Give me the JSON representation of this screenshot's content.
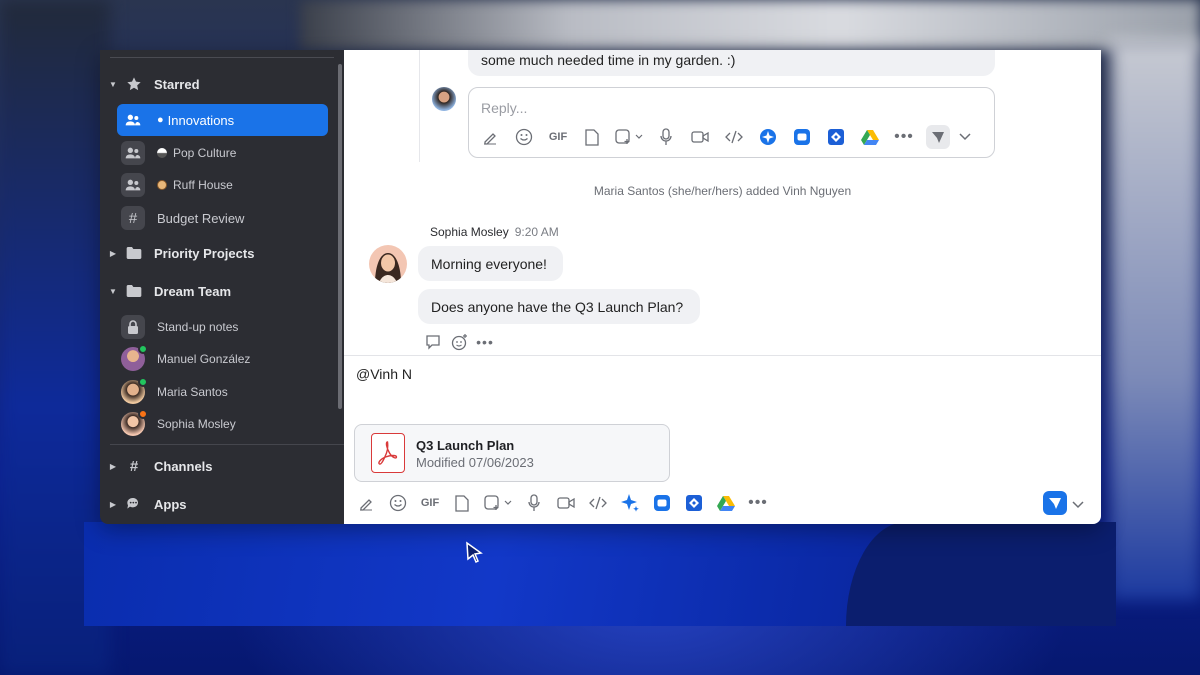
{
  "sidebar": {
    "sections": {
      "starred": "Starred",
      "priority_projects": "Priority Projects",
      "dream_team": "Dream Team",
      "channels": "Channels",
      "apps": "Apps"
    },
    "starred_items": [
      {
        "label": "Innovations",
        "active": true
      },
      {
        "label": "Pop Culture",
        "active": false
      },
      {
        "label": "Ruff House",
        "active": false
      },
      {
        "label": "Budget Review",
        "active": false
      }
    ],
    "dream_team_items": [
      {
        "label": "Stand-up notes"
      },
      {
        "label": "Manuel González",
        "presence": "#22c55e"
      },
      {
        "label": "Maria Santos",
        "presence": "#22c55e"
      },
      {
        "label": "Sophia Mosley",
        "presence": "#f97316"
      }
    ]
  },
  "chat": {
    "prev_message": "some much needed time in my garden. :)",
    "reply_placeholder": "Reply...",
    "system_message": "Maria Santos (she/her/hers) added Vinh Nguyen",
    "sender": "Sophia Mosley",
    "time": "9:20 AM",
    "messages": [
      "Morning everyone!",
      "Does anyone have the Q3 Launch Plan?"
    ]
  },
  "toolbar": {
    "gif_label": "GIF"
  },
  "compose": {
    "text": "@Vinh N",
    "attachment": {
      "name": "Q3 Launch Plan",
      "modified": "Modified 07/06/2023"
    }
  },
  "colors": {
    "accent": "#1a73e8",
    "sidebar_bg": "#2c2d33",
    "bubble_bg": "#f0f1f4",
    "pdf_red": "#d93a3a"
  }
}
